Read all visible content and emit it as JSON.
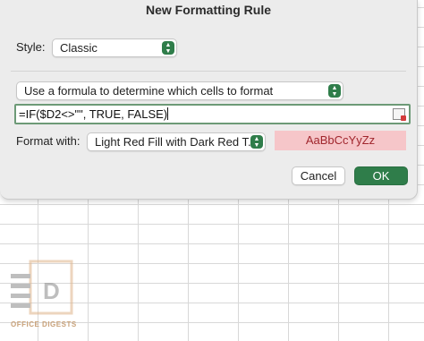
{
  "dialog": {
    "title": "New Formatting Rule"
  },
  "style_row": {
    "label": "Style:",
    "selected": "Classic"
  },
  "rule_type": {
    "selected": "Use a formula to determine which cells to format"
  },
  "formula": {
    "value": "=IF($D2<>\"\", TRUE, FALSE)"
  },
  "format_row": {
    "label": "Format with:",
    "selected": "Light Red Fill with Dark Red T...",
    "preview_text": "AaBbCcYyZz"
  },
  "buttons": {
    "cancel": "Cancel",
    "ok": "OK"
  },
  "watermark": {
    "text": "OFFICE DIGESTS"
  },
  "colors": {
    "accent": "#2f7d4a",
    "preview_fill": "#f6c6c9",
    "preview_text": "#a0262d"
  }
}
